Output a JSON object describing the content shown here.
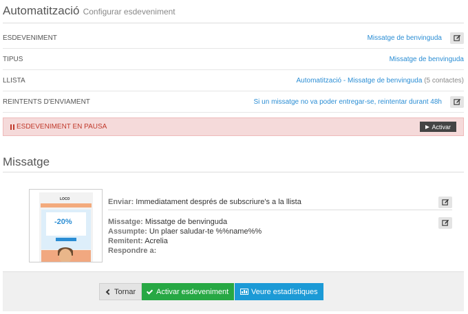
{
  "header": {
    "title": "Automatització",
    "subtitle": "Configurar esdeveniment"
  },
  "settings": [
    {
      "label": "ESDEVENIMENT",
      "value": "Missatge de benvinguda",
      "extra": "",
      "editable": true
    },
    {
      "label": "TIPUS",
      "value": "Missatge de benvinguda",
      "extra": "",
      "editable": false
    },
    {
      "label": "LLISTA",
      "value": "Automatització - Missatge de benvinguda",
      "extra": "(5 contactes)",
      "editable": false
    },
    {
      "label": "REINTENTS D'ENVIAMENT",
      "value": "Si un missatge no va poder entregar-se, reintentar durant 48h",
      "extra": "",
      "editable": true
    }
  ],
  "paused": {
    "text": "ESDEVENIMENT EN PAUSA",
    "activate_label": "Activar"
  },
  "message_section": {
    "title": "Missatge",
    "thumbnail": {
      "logo": "LOCO",
      "discount": "-20%"
    },
    "send": {
      "key": "Enviar:",
      "value": "Immediatament després de subscriure's a la llista"
    },
    "details": [
      {
        "key": "Missatge:",
        "value": "Missatge de benvinguda"
      },
      {
        "key": "Assumpte:",
        "value": "Un plaer saludar-te %%name%%"
      },
      {
        "key": "Remitent:",
        "value": "Acrelia"
      },
      {
        "key": "Respondre a:",
        "value": ""
      }
    ]
  },
  "footer": {
    "back_label": "Tornar",
    "activate_label": "Activar esdeveniment",
    "stats_label": "Veure estadístiques"
  },
  "colors": {
    "link": "#2a8dd4",
    "success": "#27a844",
    "info": "#1c9ad6",
    "danger_bg": "#f5dada",
    "danger_text": "#c0392b"
  },
  "icons": [
    "edit-icon",
    "pause-icon",
    "play-icon",
    "chevron-left-icon",
    "check-icon",
    "bar-chart-icon"
  ]
}
